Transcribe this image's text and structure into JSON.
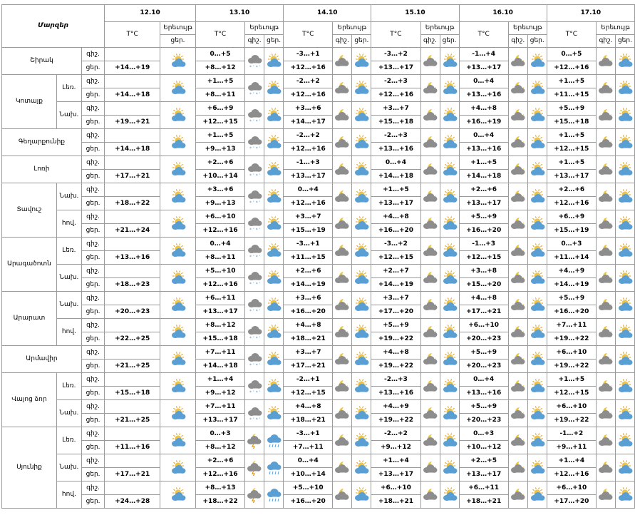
{
  "header": {
    "title": "Մարզեր",
    "temp_label": "T°C",
    "weather_label": "Երեւույթ",
    "night": "գիշ.",
    "day": "ցեր.",
    "dates": [
      "12.10",
      "13.10",
      "14.10",
      "15.10",
      "16.10",
      "17.10"
    ]
  },
  "regions": [
    {
      "name": "Շիրակ",
      "zones": [
        {
          "label": "",
          "temps": {
            "night": [
              "",
              "0…+5",
              "-3…+1",
              "-3…+2",
              "-1…+4",
              "0…+5"
            ],
            "day": [
              "+14…+19",
              "+8…+12",
              "+12…+16",
              "+13…+17",
              "+13…+17",
              "+12…+16"
            ]
          }
        }
      ]
    },
    {
      "name": "Կոտայք",
      "zones": [
        {
          "label": "Լեռ.",
          "temps": {
            "night": [
              "",
              "+1…+5",
              "-2…+2",
              "-2…+3",
              "0…+4",
              "+1…+5"
            ],
            "day": [
              "+14…+18",
              "+8…+11",
              "+12…+16",
              "+12…+16",
              "+13…+16",
              "+11…+15"
            ]
          }
        },
        {
          "label": "Նախ.",
          "temps": {
            "night": [
              "",
              "+6…+9",
              "+3…+6",
              "+3…+7",
              "+4…+8",
              "+5…+9"
            ],
            "day": [
              "+19…+21",
              "+12…+15",
              "+14…+17",
              "+15…+18",
              "+16…+19",
              "+15…+18"
            ]
          }
        }
      ]
    },
    {
      "name": "Գեղարքունիք",
      "zones": [
        {
          "label": "",
          "temps": {
            "night": [
              "",
              "+1…+5",
              "-2…+2",
              "-2…+3",
              "0…+4",
              "+1…+5"
            ],
            "day": [
              "+14…+18",
              "+9…+13",
              "+12…+16",
              "+13…+16",
              "+13…+16",
              "+12…+15"
            ]
          }
        }
      ]
    },
    {
      "name": "Լոռի",
      "zones": [
        {
          "label": "",
          "temps": {
            "night": [
              "",
              "+2…+6",
              "-1…+3",
              "0…+4",
              "+1…+5",
              "+1…+5"
            ],
            "day": [
              "+17…+21",
              "+10…+14",
              "+13…+17",
              "+14…+18",
              "+14…+18",
              "+13…+17"
            ]
          }
        }
      ]
    },
    {
      "name": "Տավուշ",
      "zones": [
        {
          "label": "Նախ.",
          "temps": {
            "night": [
              "",
              "+3…+6",
              "0…+4",
              "+1…+5",
              "+2…+6",
              "+2…+6"
            ],
            "day": [
              "+18…+22",
              "+9…+13",
              "+12…+16",
              "+13…+17",
              "+13…+17",
              "+12…+16"
            ]
          }
        },
        {
          "label": "հով.",
          "temps": {
            "night": [
              "",
              "+6…+10",
              "+3…+7",
              "+4…+8",
              "+5…+9",
              "+6…+9"
            ],
            "day": [
              "+21…+24",
              "+12…+16",
              "+15…+19",
              "+16…+20",
              "+16…+20",
              "+15…+19"
            ]
          }
        }
      ]
    },
    {
      "name": "Արագածոտն",
      "zones": [
        {
          "label": "Լեռ.",
          "temps": {
            "night": [
              "",
              "0…+4",
              "-3…+1",
              "-3…+2",
              "-1…+3",
              "0…+3"
            ],
            "day": [
              "+13…+16",
              "+8…+11",
              "+11…+15",
              "+12…+15",
              "+12…+15",
              "+11…+14"
            ]
          }
        },
        {
          "label": "Նախ.",
          "temps": {
            "night": [
              "",
              "+5…+10",
              "+2…+6",
              "+2…+7",
              "+3…+8",
              "+4…+9"
            ],
            "day": [
              "+18…+23",
              "+12…+16",
              "+14…+19",
              "+14…+19",
              "+15…+20",
              "+14…+19"
            ]
          }
        }
      ]
    },
    {
      "name": "Արարատ",
      "zones": [
        {
          "label": "Նախ.",
          "temps": {
            "night": [
              "",
              "+6…+11",
              "+3…+6",
              "+3…+7",
              "+4…+8",
              "+5…+9"
            ],
            "day": [
              "+20…+23",
              "+13…+17",
              "+16…+20",
              "+17…+20",
              "+17…+21",
              "+16…+20"
            ]
          }
        },
        {
          "label": "հով.",
          "temps": {
            "night": [
              "",
              "+8…+12",
              "+4…+8",
              "+5…+9",
              "+6…+10",
              "+7…+11"
            ],
            "day": [
              "+22…+25",
              "+15…+18",
              "+18…+21",
              "+19…+22",
              "+20…+23",
              "+19…+22"
            ]
          }
        }
      ]
    },
    {
      "name": "Արմավիր",
      "zones": [
        {
          "label": "",
          "temps": {
            "night": [
              "",
              "+7…+11",
              "+3…+7",
              "+4…+8",
              "+5…+9",
              "+6…+10"
            ],
            "day": [
              "+21…+25",
              "+14…+18",
              "+17…+21",
              "+19…+22",
              "+20…+23",
              "+19…+22"
            ]
          }
        }
      ]
    },
    {
      "name": "Վայոց ձոր",
      "zones": [
        {
          "label": "Լեռ.",
          "temps": {
            "night": [
              "",
              "+1…+4",
              "-2…+1",
              "-2…+3",
              "0…+4",
              "+1…+5"
            ],
            "day": [
              "+15…+18",
              "+9…+12",
              "+12…+15",
              "+13…+16",
              "+13…+16",
              "+12…+15"
            ]
          }
        },
        {
          "label": "Նախ.",
          "temps": {
            "night": [
              "",
              "+7…+11",
              "+4…+8",
              "+4…+9",
              "+5…+9",
              "+6…+10"
            ],
            "day": [
              "+21…+25",
              "+13…+17",
              "+18…+21",
              "+19…+22",
              "+20…+23",
              "+19…+22"
            ]
          }
        }
      ]
    },
    {
      "name": "Սյունիք",
      "zones": [
        {
          "label": "Լեռ.",
          "temps": {
            "night": [
              "",
              "0…+3",
              "-3…+1",
              "-2…+2",
              "0…+3",
              "-1…+2"
            ],
            "day": [
              "+11…+16",
              "+8…+12",
              "+7…+11",
              "+9…+12",
              "+10…+12",
              "+9…+11"
            ]
          }
        },
        {
          "label": "Նախ.",
          "temps": {
            "night": [
              "",
              "+2…+6",
              "0…+4",
              "+1…+4",
              "+2…+5",
              "+1…+4"
            ],
            "day": [
              "+17…+21",
              "+12…+16",
              "+10…+14",
              "+13…+17",
              "+13…+17",
              "+12…+16"
            ]
          }
        },
        {
          "label": "հով.",
          "temps": {
            "night": [
              "",
              "+8…+13",
              "+5…+10",
              "+6…+10",
              "+6…+11",
              "+6…+10"
            ],
            "day": [
              "+24…+28",
              "+18…+22",
              "+16…+20",
              "+18…+21",
              "+18…+21",
              "+17…+20"
            ]
          }
        }
      ]
    }
  ],
  "icons": {
    "partly_cloudy_day": "sun-behind-cloud-icon",
    "cloudy_night": "moon-behind-gray-cloud-icon",
    "cloudy_day": "sun-behind-cloud-icon",
    "rain_snow": "cloud-rain-snow-icon",
    "rain": "cloud-rain-icon",
    "thunder": "cloud-thunder-icon"
  },
  "colors": {
    "border": "#9a9a9a",
    "sun": "#f4c33c",
    "sun_stroke": "#e09a12",
    "cloud_blue": "#5a9fd4",
    "cloud_gray": "#8d8d8d",
    "moon": "#e8c640"
  }
}
